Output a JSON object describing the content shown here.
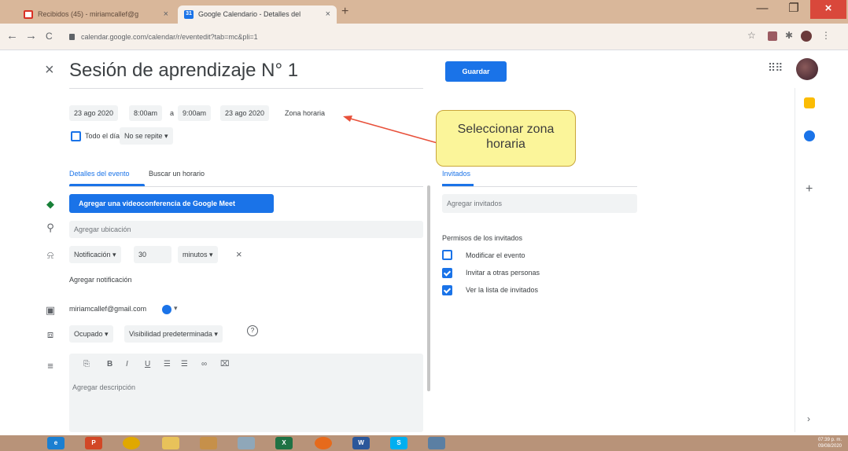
{
  "browser": {
    "tabs": [
      {
        "title": "Recibidos (45) - miriamcallef@g",
        "icon": "gmail-icon",
        "active": false
      },
      {
        "title": "Google Calendario - Detalles del",
        "icon": "calendar-icon",
        "active": true
      }
    ],
    "new_tab": "+",
    "url": "calendar.google.com/calendar/r/eventedit?tab=mc&pli=1",
    "nav": {
      "back": "←",
      "forward": "→",
      "reload": "C"
    },
    "window": {
      "minimize": "—",
      "maximize": "❐",
      "close": "×"
    }
  },
  "event": {
    "close": "×",
    "title": "Sesión de aprendizaje N° 1",
    "start_date": "23 ago 2020",
    "start_time": "8:00am",
    "separator": "a",
    "end_time": "9:00am",
    "end_date": "23 ago 2020",
    "timezone": "Zona horaria",
    "all_day": "Todo el día",
    "repeat": "No se repite",
    "save": "Guardar"
  },
  "tabs_left": {
    "details": "Detalles del evento",
    "find_time": "Buscar un horario"
  },
  "meet_button": "Agregar una videoconferencia de Google Meet",
  "location_placeholder": "Agregar ubicación",
  "notification": {
    "type": "Notificación",
    "value": "30",
    "unit": "minutos",
    "remove": "×",
    "add": "Agregar notificación"
  },
  "calendar_account": "miriamcallef@gmail.com",
  "availability": "Ocupado",
  "visibility": "Visibilidad predeterminada",
  "help": "?",
  "description_placeholder": "Agregar descripción",
  "guests": {
    "tab": "Invitados",
    "add_placeholder": "Agregar invitados",
    "permissions_title": "Permisos de los invitados",
    "permissions": [
      {
        "label": "Modificar el evento",
        "checked": false
      },
      {
        "label": "Invitar a otras personas",
        "checked": true
      },
      {
        "label": "Ver la lista de invitados",
        "checked": true
      }
    ]
  },
  "callout": {
    "line1": "Seleccionar zona",
    "line2": "horaria"
  },
  "side": {
    "plus": "+",
    "chevron": "›"
  },
  "taskbar": {
    "time": "07:39 p. m.",
    "date": "09/08/2020"
  },
  "colors": {
    "accent": "#1a73e8",
    "callout_bg": "#fbf59a",
    "arrow": "#e8503a"
  }
}
